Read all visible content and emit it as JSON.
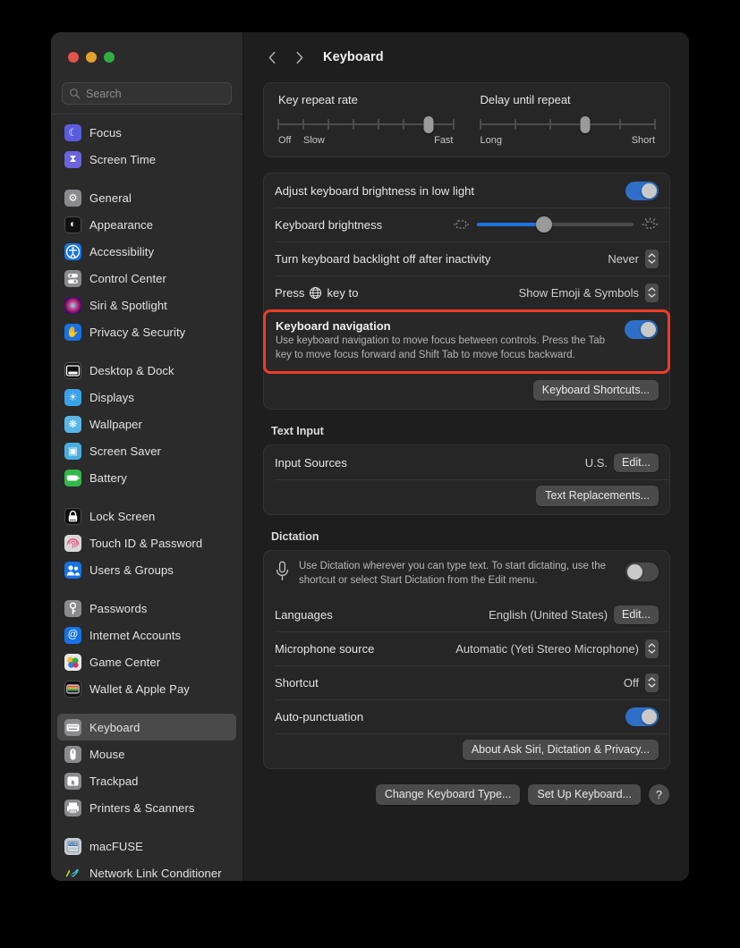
{
  "window": {
    "traffic_lights": [
      "close",
      "minimize",
      "zoom"
    ],
    "colors": {
      "close": "#e0544b",
      "minimize": "#e0a22b",
      "zoom": "#2fae41",
      "accent_blue": "#2f6fc8",
      "slider_blue": "#1d72e0",
      "highlight_red": "#ef3b28"
    }
  },
  "search": {
    "placeholder": "Search",
    "value": "",
    "icon": "search-icon"
  },
  "sidebar": {
    "groups": [
      {
        "items": [
          {
            "label": "Focus",
            "icon": "focus-icon"
          },
          {
            "label": "Screen Time",
            "icon": "screen-time-icon"
          }
        ]
      },
      {
        "items": [
          {
            "label": "General",
            "icon": "general-icon"
          },
          {
            "label": "Appearance",
            "icon": "appearance-icon"
          },
          {
            "label": "Accessibility",
            "icon": "accessibility-icon"
          },
          {
            "label": "Control Center",
            "icon": "control-center-icon"
          },
          {
            "label": "Siri & Spotlight",
            "icon": "siri-icon"
          },
          {
            "label": "Privacy & Security",
            "icon": "privacy-icon"
          }
        ]
      },
      {
        "items": [
          {
            "label": "Desktop & Dock",
            "icon": "desktop-dock-icon"
          },
          {
            "label": "Displays",
            "icon": "displays-icon"
          },
          {
            "label": "Wallpaper",
            "icon": "wallpaper-icon"
          },
          {
            "label": "Screen Saver",
            "icon": "screen-saver-icon"
          },
          {
            "label": "Battery",
            "icon": "battery-icon"
          }
        ]
      },
      {
        "items": [
          {
            "label": "Lock Screen",
            "icon": "lock-screen-icon"
          },
          {
            "label": "Touch ID & Password",
            "icon": "touch-id-icon"
          },
          {
            "label": "Users & Groups",
            "icon": "users-groups-icon"
          }
        ]
      },
      {
        "items": [
          {
            "label": "Passwords",
            "icon": "passwords-icon"
          },
          {
            "label": "Internet Accounts",
            "icon": "internet-accounts-icon"
          },
          {
            "label": "Game Center",
            "icon": "game-center-icon"
          },
          {
            "label": "Wallet & Apple Pay",
            "icon": "wallet-icon"
          }
        ]
      },
      {
        "items": [
          {
            "label": "Keyboard",
            "icon": "keyboard-icon",
            "selected": true
          },
          {
            "label": "Mouse",
            "icon": "mouse-icon"
          },
          {
            "label": "Trackpad",
            "icon": "trackpad-icon"
          },
          {
            "label": "Printers & Scanners",
            "icon": "printers-icon"
          }
        ]
      },
      {
        "items": [
          {
            "label": "macFUSE",
            "icon": "macfuse-icon"
          },
          {
            "label": "Network Link Conditioner",
            "icon": "network-link-icon"
          }
        ]
      }
    ]
  },
  "toolbar": {
    "back_icon": "chevron-left-icon",
    "forward_icon": "chevron-right-icon",
    "title": "Keyboard"
  },
  "key_repeat": {
    "label": "Key repeat rate",
    "ticks": 8,
    "knob_index": 6,
    "label_left": "Off",
    "label_second": "Slow",
    "label_right": "Fast"
  },
  "delay_repeat": {
    "label": "Delay until repeat",
    "ticks": 6,
    "knob_index": 3,
    "label_left": "Long",
    "label_right": "Short"
  },
  "backlight": {
    "adjust_label": "Adjust keyboard brightness in low light",
    "adjust_on": true,
    "brightness_label": "Keyboard brightness",
    "brightness_percent": 43,
    "brightness_low_icon": "brightness-low-icon",
    "brightness_high_icon": "brightness-high-icon",
    "inactivity_label": "Turn keyboard backlight off after inactivity",
    "inactivity_value": "Never",
    "globe_label_before": "Press",
    "globe_icon": "globe-icon",
    "globe_label_after": "key to",
    "globe_value": "Show Emoji & Symbols"
  },
  "keyboard_navigation": {
    "title": "Keyboard navigation",
    "description": "Use keyboard navigation to move focus between controls. Press the Tab key to move focus forward and Shift Tab to move focus backward.",
    "enabled": true,
    "shortcuts_button": "Keyboard Shortcuts...",
    "highlighted": true
  },
  "text_input": {
    "section_title": "Text Input",
    "input_sources_label": "Input Sources",
    "input_sources_value": "U.S.",
    "edit_button": "Edit...",
    "text_replacements_button": "Text Replacements..."
  },
  "dictation": {
    "section_title": "Dictation",
    "icon": "microphone-icon",
    "description": "Use Dictation wherever you can type text. To start dictating, use the shortcut or select Start Dictation from the Edit menu.",
    "enabled": false,
    "languages_label": "Languages",
    "languages_value": "English (United States)",
    "languages_edit_button": "Edit...",
    "mic_source_label": "Microphone source",
    "mic_source_value": "Automatic (Yeti Stereo Microphone)",
    "shortcut_label": "Shortcut",
    "shortcut_value": "Off",
    "auto_punctuation_label": "Auto-punctuation",
    "auto_punctuation_on": true,
    "about_button": "About Ask Siri, Dictation & Privacy..."
  },
  "footer": {
    "change_type_button": "Change Keyboard Type...",
    "set_up_button": "Set Up Keyboard...",
    "help_button": "?"
  }
}
